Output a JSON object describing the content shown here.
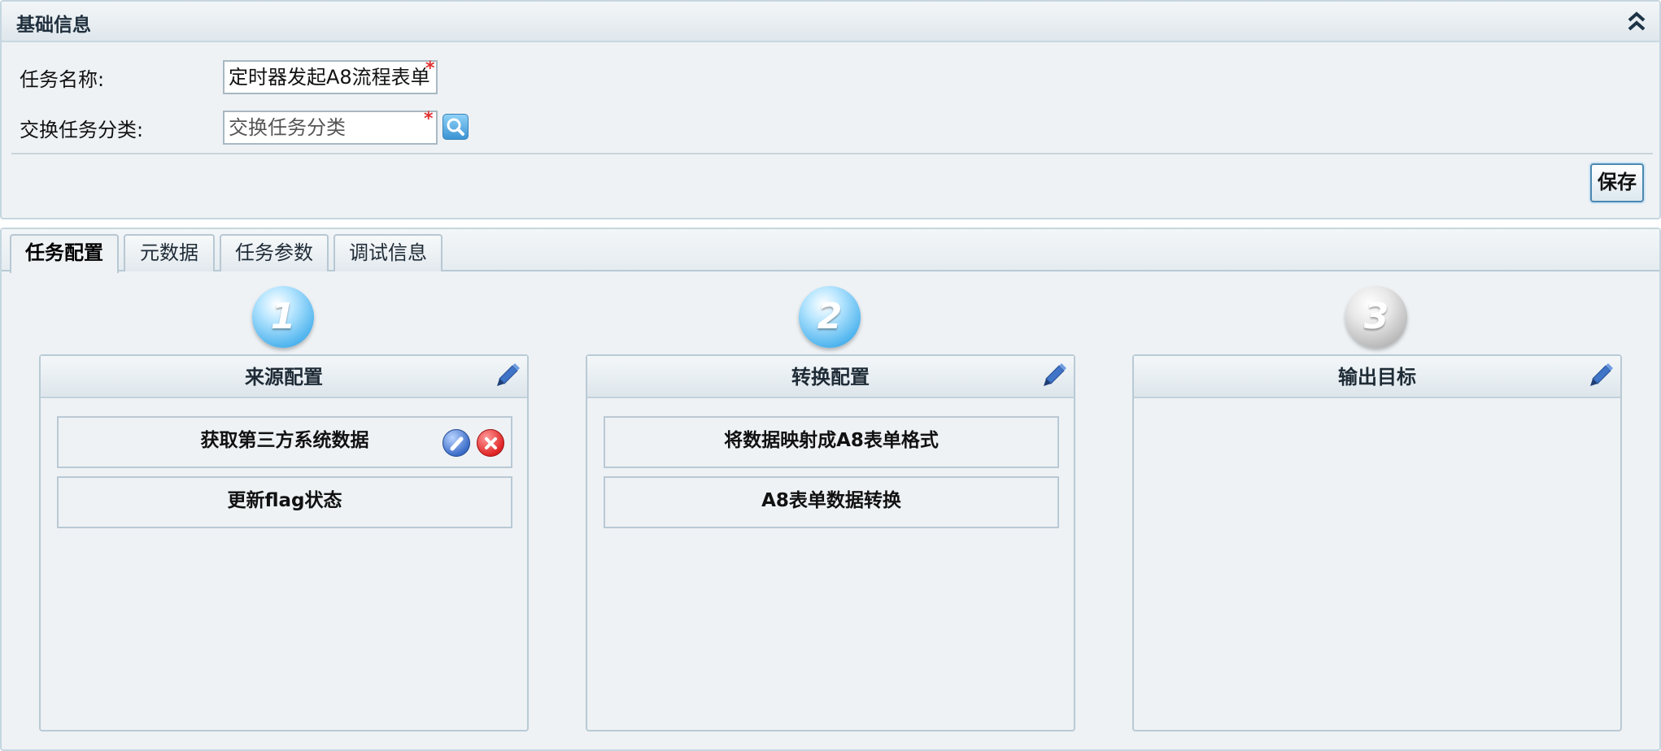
{
  "basic_info": {
    "title": "基础信息",
    "task_name_label": "任务名称:",
    "task_name_value": "定时器发起A8流程表单",
    "category_label": "交换任务分类:",
    "category_placeholder": "交换任务分类",
    "required_mark": "*",
    "save_label": "保存"
  },
  "tabs": [
    {
      "label": "任务配置",
      "active": true
    },
    {
      "label": "元数据",
      "active": false
    },
    {
      "label": "任务参数",
      "active": false
    },
    {
      "label": "调试信息",
      "active": false
    }
  ],
  "columns": [
    {
      "step": "1",
      "step_state": "active",
      "title": "来源配置",
      "items": [
        "获取第三方系统数据",
        "更新flag状态"
      ]
    },
    {
      "step": "2",
      "step_state": "active",
      "title": "转换配置",
      "items": [
        "将数据映射成A8表单格式",
        "A8表单数据转换"
      ]
    },
    {
      "step": "3",
      "step_state": "inactive",
      "title": "输出目标",
      "items": []
    }
  ],
  "icons": {
    "collapse": "double-chevron-up-icon",
    "search": "magnifier-icon",
    "edit": "pencil-icon",
    "item_edit": "edit-circle-icon",
    "item_delete": "delete-circle-icon"
  },
  "colors": {
    "step_active": "#4fb4ee",
    "step_inactive": "#b4b4b4",
    "required": "#e23131",
    "delete": "#e12626",
    "panel_bg": "#eef2f5"
  }
}
